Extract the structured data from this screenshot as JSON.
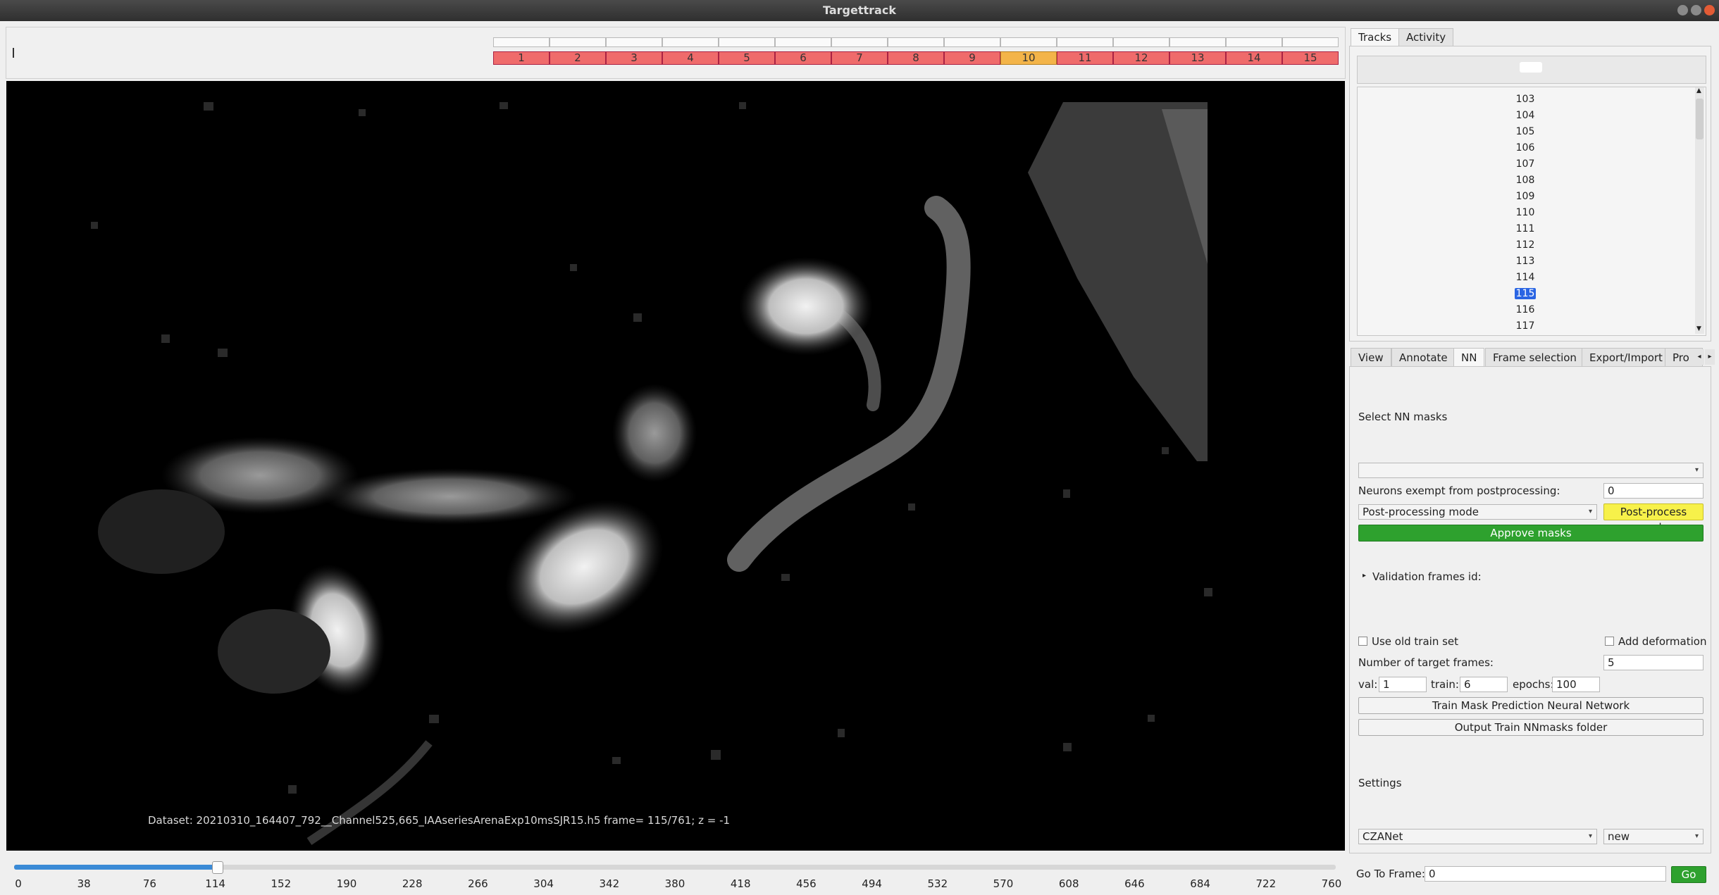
{
  "window": {
    "title": "Targettrack"
  },
  "frame_cells": [
    "1",
    "2",
    "3",
    "4",
    "5",
    "6",
    "7",
    "8",
    "9",
    "10",
    "11",
    "12",
    "13",
    "14",
    "15"
  ],
  "active_cell": "10",
  "viewer": {
    "dataset_info": "Dataset: 20210310_164407_792__Channel525,665_IAAseriesArenaExp10msSJR15.h5 frame= 115/761; z = -1"
  },
  "timeline": {
    "ticks": [
      "0",
      "38",
      "76",
      "114",
      "152",
      "190",
      "228",
      "266",
      "304",
      "342",
      "380",
      "418",
      "456",
      "494",
      "532",
      "570",
      "608",
      "646",
      "684",
      "722",
      "760"
    ],
    "current_frame": 115,
    "max_frame": 760
  },
  "right_tabs": [
    "Tracks",
    "Activity"
  ],
  "tracks": [
    "103",
    "104",
    "105",
    "106",
    "107",
    "108",
    "109",
    "110",
    "111",
    "112",
    "113",
    "114",
    "115",
    "116",
    "117"
  ],
  "selected_track": "115",
  "sub_tabs": [
    "View",
    "Annotate",
    "NN",
    "Frame selection",
    "Export/Import",
    "Pro"
  ],
  "nn": {
    "select_masks_label": "Select NN masks",
    "exempt_label": "Neurons exempt from postprocessing:",
    "exempt_value": "0",
    "postprocess_mode": "Post-processing mode",
    "postprocess_button": "Post-process masks",
    "approve_button": "Approve masks",
    "validation_label": "Validation frames id:",
    "use_old_train_label": "Use old train set",
    "add_deformation_label": "Add deformation",
    "target_frames_label": "Number of target frames:",
    "target_frames_value": "5",
    "val_label": "val:",
    "val_value": "1",
    "train_label": "train:",
    "train_value": "6",
    "epochs_label": "epochs:",
    "epochs_value": "100",
    "train_button": "Train Mask Prediction Neural Network",
    "output_button": "Output Train NNmasks folder",
    "settings_label": "Settings",
    "model_select": "CZANet",
    "version_select": "new",
    "goto_label": "Go To Frame:",
    "goto_value": "0",
    "go_button": "Go"
  },
  "colors": {
    "cell_red": "#ef6b6b",
    "cell_active": "#f3b449",
    "approve_green": "#2ea12e",
    "postprocess_yellow": "#f7f14a",
    "selection_blue": "#2a65e3"
  }
}
